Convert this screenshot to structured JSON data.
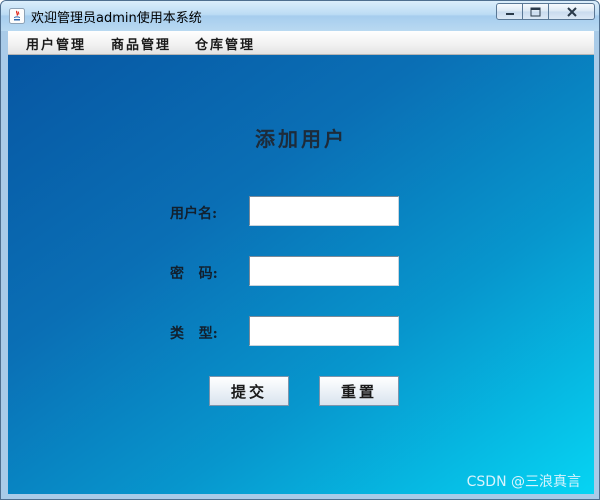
{
  "window": {
    "title": "欢迎管理员admin使用本系统"
  },
  "menu": {
    "items": [
      "用户管理",
      "商品管理",
      "仓库管理"
    ]
  },
  "form": {
    "title": "添加用户",
    "fields": [
      {
        "label": "用户名:",
        "value": ""
      },
      {
        "label": "密   码:",
        "value": ""
      },
      {
        "label": "类   型:",
        "value": ""
      }
    ],
    "submit_label": "提交",
    "reset_label": "重置"
  },
  "watermark": "CSDN @三浪真言",
  "colors": {
    "gradient_start": "#0757a3",
    "gradient_end": "#06d4f3",
    "titlebar": "#bcdcf4"
  }
}
